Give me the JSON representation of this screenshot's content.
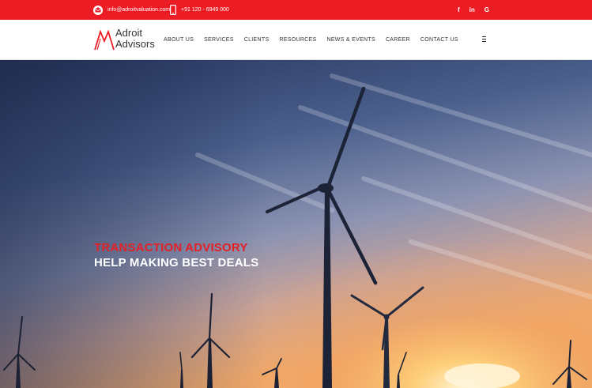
{
  "topbar": {
    "email": "info@adroitvaluation.com",
    "phone": "+91 120 - 6949 000",
    "social": [
      {
        "icon": "facebook-icon",
        "glyph": "f"
      },
      {
        "icon": "linkedin-icon",
        "glyph": "in"
      },
      {
        "icon": "google-icon",
        "glyph": "G"
      }
    ]
  },
  "brand": {
    "line1": "Adroit",
    "line2": "Advisors",
    "accent_color": "#ec1c24"
  },
  "nav": {
    "items": [
      "ABOUT US",
      "SERVICES",
      "CLIENTS",
      "RESOURCES",
      "NEWS & EVENTS",
      "CAREER",
      "CONTACT US"
    ],
    "menu_icon": "hamburger-icon"
  },
  "hero": {
    "line1": "TRANSACTION ADVISORY",
    "line2": "HELP MAKING BEST DEALS",
    "line1_color": "#e32127",
    "line2_color": "#ffffff",
    "background": "wind-turbines-at-sunset"
  }
}
